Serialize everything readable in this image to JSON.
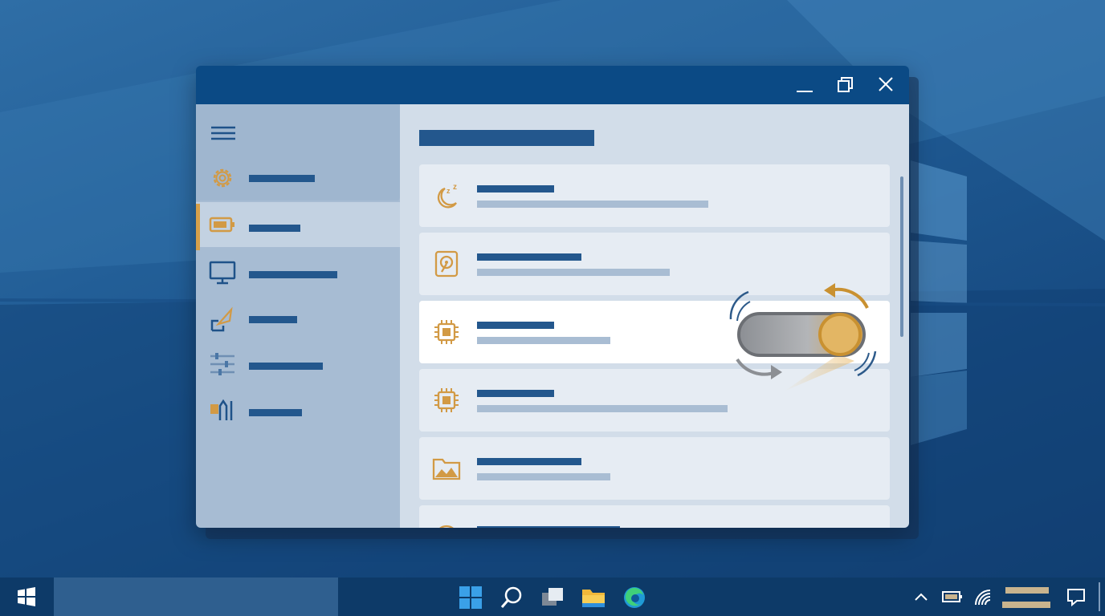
{
  "window": {
    "title": "",
    "controls": [
      "minimize-icon",
      "restore-icon",
      "close-icon"
    ],
    "colors": {
      "titlebar": "#0b4a85",
      "accent": "#d7a04a",
      "text_bar": "#23578d"
    }
  },
  "sidebar": {
    "menu_icon": "hamburger-icon",
    "items": [
      {
        "icon": "gear-icon",
        "label": "",
        "selected": false
      },
      {
        "icon": "battery-icon",
        "label": "",
        "selected": true
      },
      {
        "icon": "monitor-icon",
        "label": "",
        "selected": false
      },
      {
        "icon": "share-pen-icon",
        "label": "",
        "selected": false
      },
      {
        "icon": "sliders-icon",
        "label": "",
        "selected": false
      },
      {
        "icon": "tools-icon",
        "label": "",
        "selected": false
      }
    ]
  },
  "main": {
    "title": "",
    "cards": [
      {
        "icon": "sleep-icon",
        "title": "",
        "desc": "",
        "highlighted": false
      },
      {
        "icon": "hard-disk-icon",
        "title": "",
        "desc": "",
        "highlighted": false
      },
      {
        "icon": "processor-icon",
        "title": "",
        "desc": "",
        "highlighted": true,
        "toggle": {
          "state": "on",
          "animated": true
        }
      },
      {
        "icon": "processor-icon",
        "title": "",
        "desc": "",
        "highlighted": false
      },
      {
        "icon": "image-folder-icon",
        "title": "",
        "desc": "",
        "highlighted": false
      },
      {
        "icon": "clock-icon",
        "title": "",
        "desc": "",
        "highlighted": false
      }
    ]
  },
  "taskbar": {
    "start_icon": "windows-logo-icon",
    "search_box": "",
    "pinned": [
      "start-menu-icon",
      "search-icon",
      "task-view-icon",
      "file-explorer-icon",
      "edge-icon"
    ],
    "tray": [
      "chevron-up-icon",
      "battery-icon",
      "wifi-icon",
      "clock",
      "notification-icon"
    ],
    "clock_text": ""
  }
}
